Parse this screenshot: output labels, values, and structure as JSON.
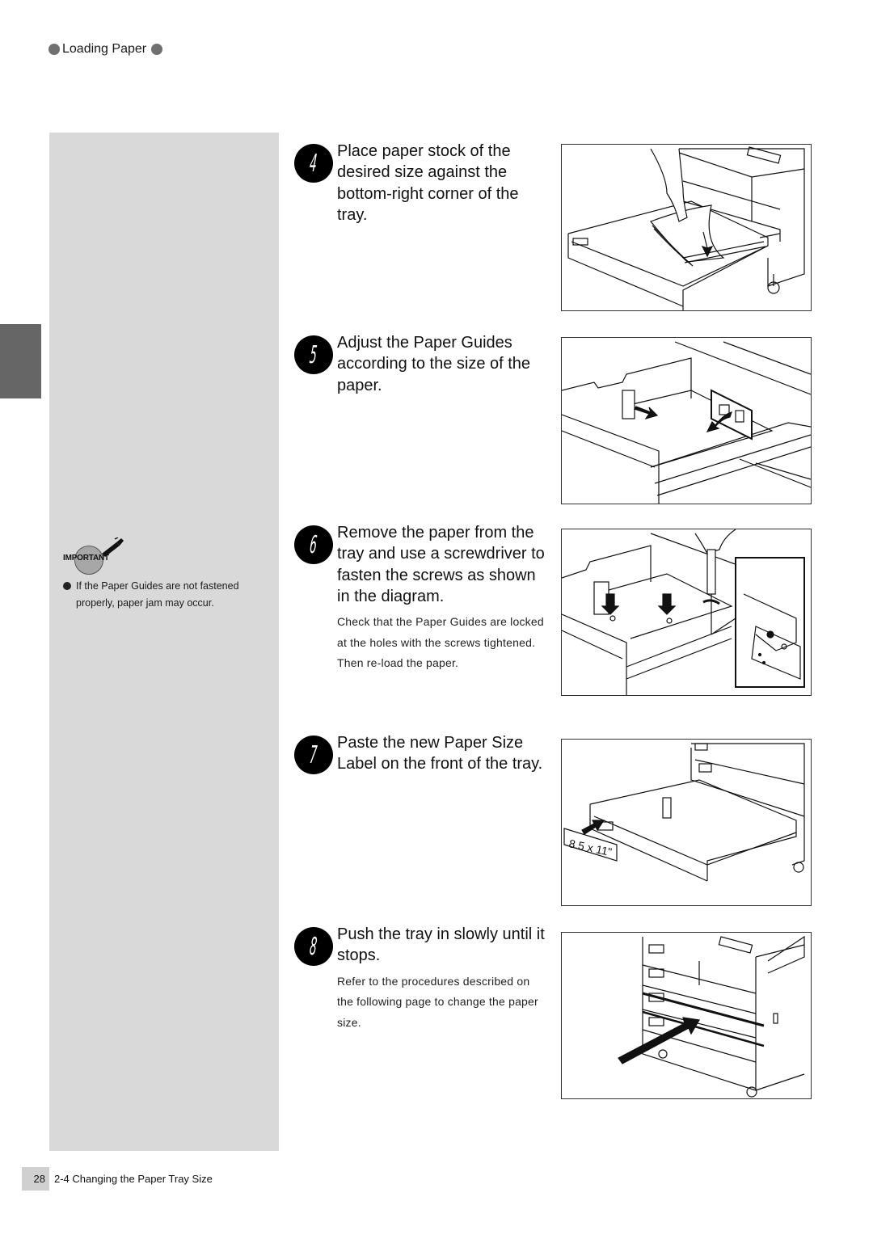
{
  "header": {
    "title": "Loading Paper"
  },
  "important": {
    "badge_label": "IMPORTANT",
    "note": "If the Paper Guides are not fastened properly, paper jam may occur."
  },
  "steps": [
    {
      "number": "4",
      "title": "Place paper stock of the desired size against the bottom-right corner of the tray.",
      "note": ""
    },
    {
      "number": "5",
      "title": "Adjust the Paper Guides according to the size of the paper.",
      "note": ""
    },
    {
      "number": "6",
      "title": "Remove the paper from the tray and use a screwdriver to fasten the screws as shown in the diagram.",
      "note": "Check that the Paper Guides are locked at the holes with the screws tightened. Then re-load the paper."
    },
    {
      "number": "7",
      "title": "Paste the new Paper Size Label on the front of the tray.",
      "note": ""
    },
    {
      "number": "8",
      "title": "Push the tray in slowly until it stops.",
      "note": "Refer to the procedures described on the following page to change the paper size."
    }
  ],
  "figures": {
    "label_text": "8.5 x 11\""
  },
  "footer": {
    "page_number": "28",
    "section": "2-4 Changing the Paper Tray Size"
  }
}
